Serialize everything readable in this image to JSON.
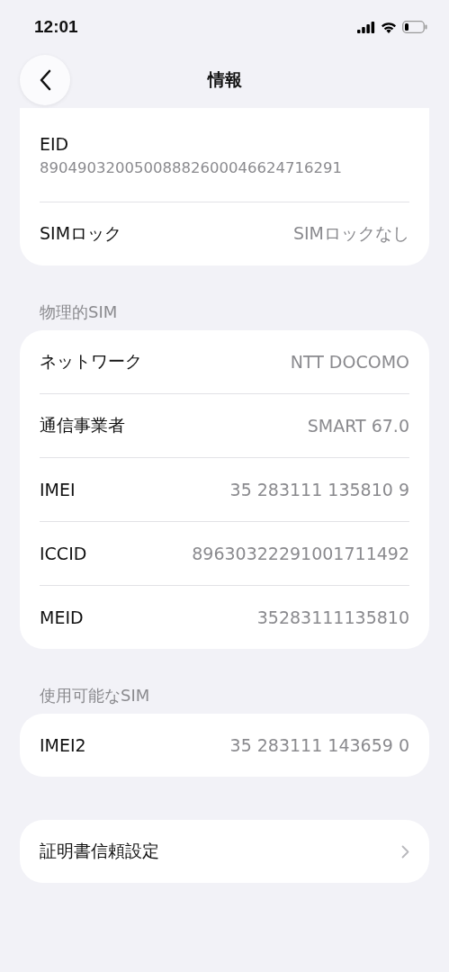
{
  "status_bar": {
    "time": "12:01"
  },
  "nav": {
    "title": "情報"
  },
  "sections": [
    {
      "rows": [
        {
          "kind": "stacked",
          "label": "EID",
          "value": "89049032005008882600046624716291"
        },
        {
          "kind": "value",
          "label": "SIMロック",
          "value": "SIMロックなし"
        }
      ]
    },
    {
      "header": "物理的SIM",
      "rows": [
        {
          "kind": "value",
          "label": "ネットワーク",
          "value": "NTT DOCOMO"
        },
        {
          "kind": "value",
          "label": "通信事業者",
          "value": "SMART 67.0"
        },
        {
          "kind": "value",
          "label": "IMEI",
          "value": "35 283111 135810 9"
        },
        {
          "kind": "value",
          "label": "ICCID",
          "value": "89630322291001711492"
        },
        {
          "kind": "value",
          "label": "MEID",
          "value": "35283111135810"
        }
      ]
    },
    {
      "header": "使用可能なSIM",
      "rows": [
        {
          "kind": "value",
          "label": "IMEI2",
          "value": "35 283111 143659 0"
        }
      ]
    },
    {
      "rows": [
        {
          "kind": "link",
          "label": "証明書信頼設定"
        }
      ]
    }
  ]
}
